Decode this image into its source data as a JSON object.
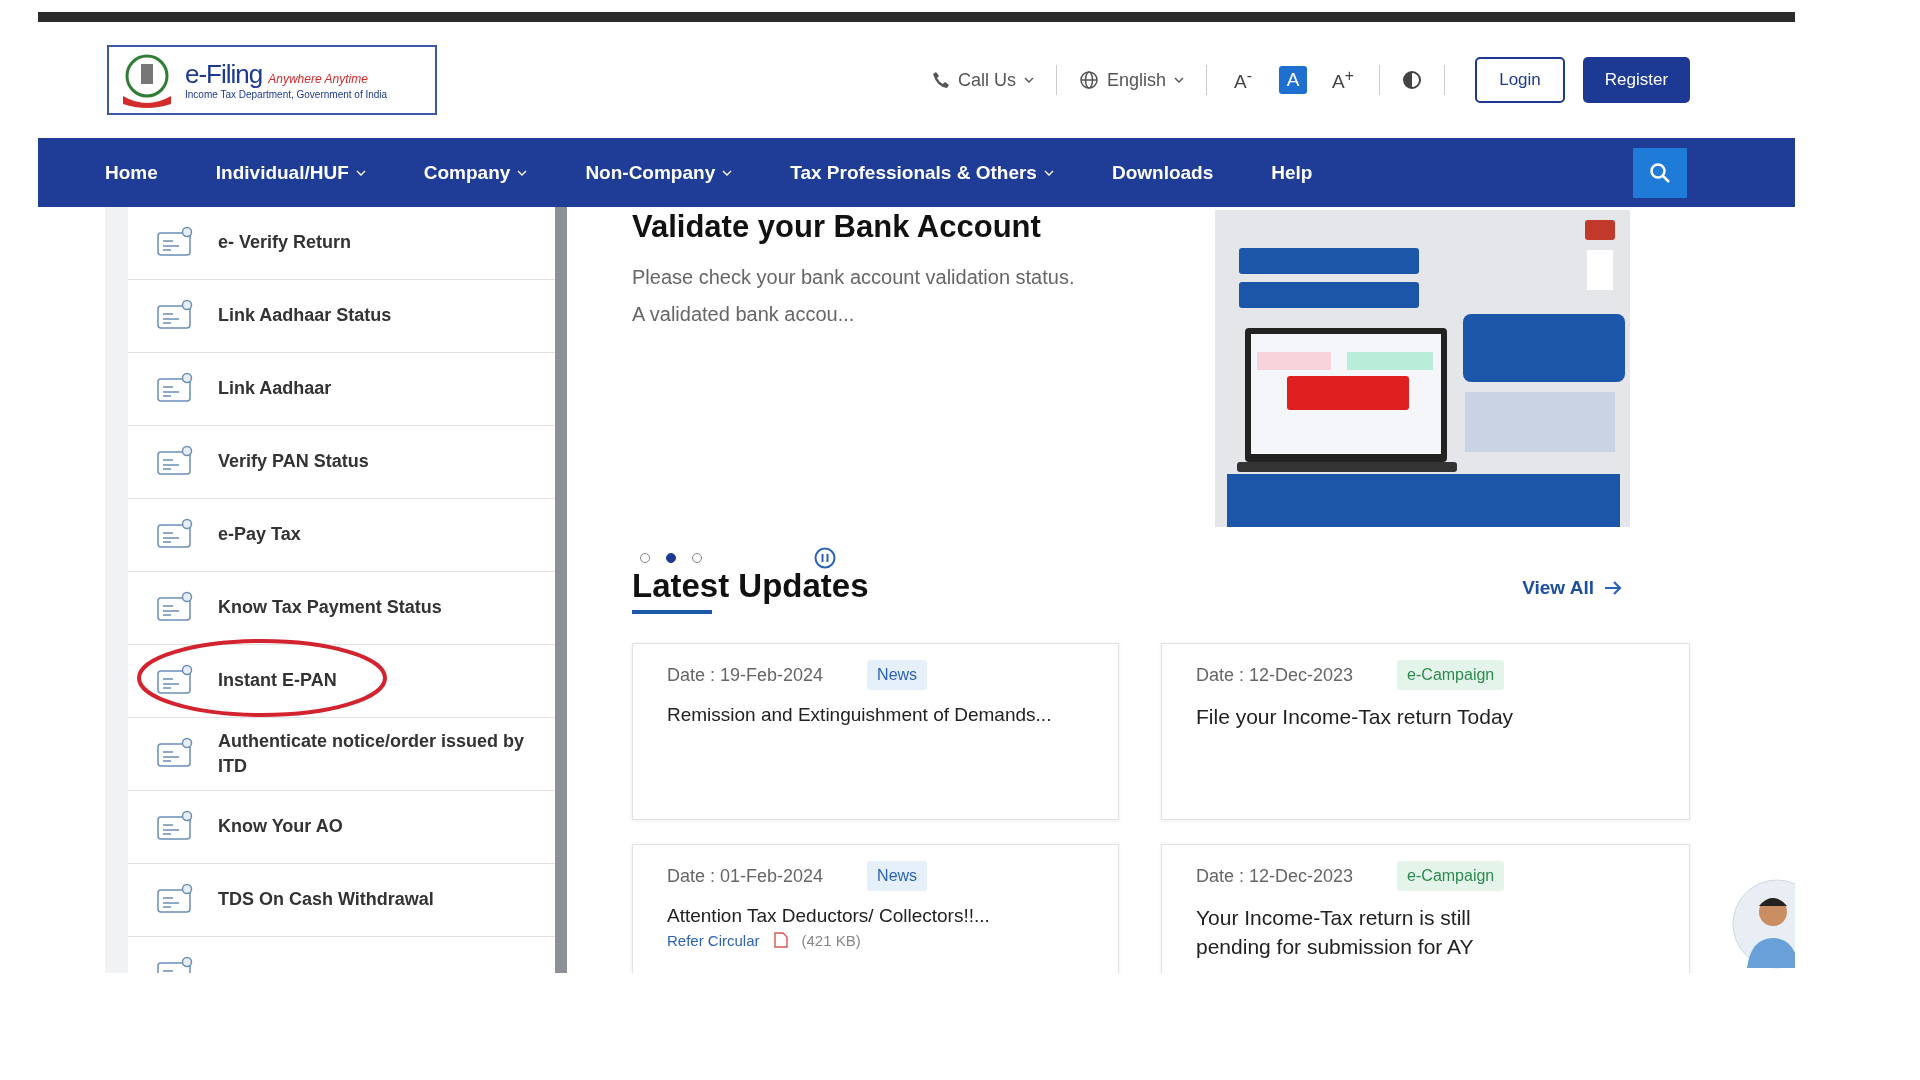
{
  "header": {
    "logo": {
      "title": "e-Filing",
      "tagline": "Anywhere Anytime",
      "subtitle": "Income Tax Department, Government of India"
    },
    "call_us": "Call Us",
    "language": "English",
    "font_sizes": [
      {
        "label": "A$^{-}$",
        "selected": false
      },
      {
        "label": "A",
        "selected": true
      },
      {
        "label": "A$^{+}$",
        "selected": false
      }
    ],
    "login": "Login",
    "register": "Register"
  },
  "nav": {
    "items": [
      {
        "label": "Home",
        "dropdown": false
      },
      {
        "label": "Individual/HUF",
        "dropdown": true
      },
      {
        "label": "Company",
        "dropdown": true
      },
      {
        "label": "Non-Company",
        "dropdown": true
      },
      {
        "label": "Tax Professionals & Others",
        "dropdown": true
      },
      {
        "label": "Downloads",
        "dropdown": false
      },
      {
        "label": "Help",
        "dropdown": false
      }
    ]
  },
  "sidebar": {
    "items": [
      {
        "label": "e- Verify Return",
        "circled": false
      },
      {
        "label": "Link Aadhaar Status",
        "circled": false
      },
      {
        "label": "Link Aadhaar",
        "circled": false
      },
      {
        "label": "Verify PAN Status",
        "circled": false
      },
      {
        "label": "e-Pay Tax",
        "circled": false
      },
      {
        "label": "Know Tax Payment Status",
        "circled": false
      },
      {
        "label": "Instant E-PAN",
        "circled": true
      },
      {
        "label": "Authenticate notice/order issued by ITD",
        "circled": false
      },
      {
        "label": "Know Your AO",
        "circled": false
      },
      {
        "label": "TDS On Cash Withdrawal",
        "circled": false
      }
    ]
  },
  "carousel": {
    "title": "Validate your Bank Account",
    "description_lines": [
      "Please check your bank account validation status.",
      "A validated bank accou..."
    ],
    "dots": [
      {
        "selected": false
      },
      {
        "selected": true
      },
      {
        "selected": false
      }
    ],
    "banner": {
      "kind": "picture"
    }
  },
  "latest_updates": {
    "heading": "Latest Updates",
    "view_all": "View All",
    "cards": [
      {
        "date": "Date : 19-Feb-2024",
        "tag": "News",
        "kind": "news",
        "title": "Remission and Extinguishment of Demands..."
      },
      {
        "date": "Date : 12-Dec-2023",
        "tag": "e-Campaign",
        "kind": "campaign",
        "title": "File your Income-Tax return Today"
      },
      {
        "date": "Date : 01-Feb-2024",
        "tag": "News",
        "kind": "news",
        "title": "Attention Tax Deductors/ Collectors!!...",
        "link": "Refer Circular",
        "file_size": "(421 KB)"
      },
      {
        "date": "Date : 12-Dec-2023",
        "tag": "e-Campaign",
        "kind": "campaign",
        "title": "Your Income-Tax return is still pending for submission for AY"
      }
    ]
  }
}
